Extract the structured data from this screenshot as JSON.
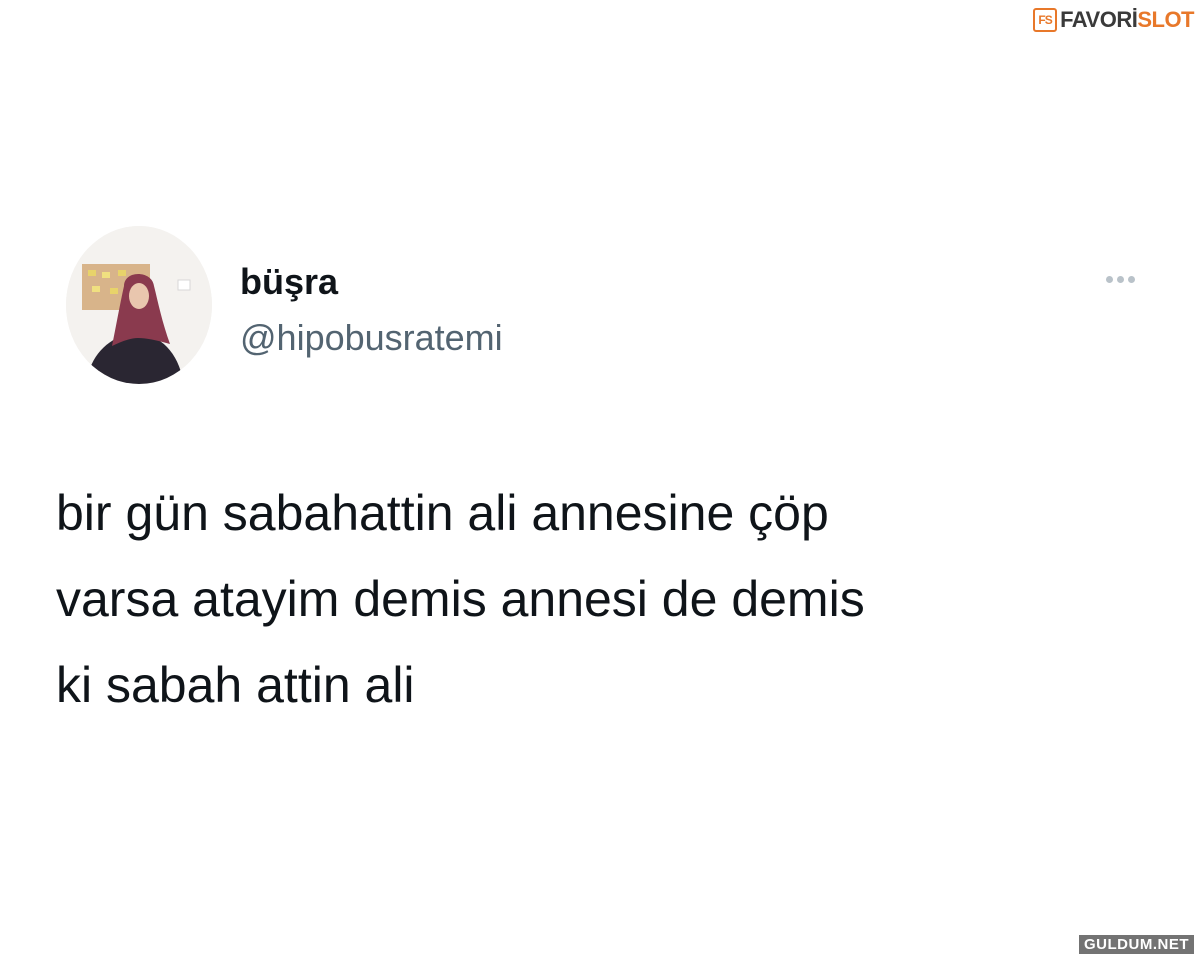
{
  "watermark": {
    "logo_mark": "FS",
    "brand_part1": "FAVORİ",
    "brand_part2": "SLOT",
    "accent_color": "#e8782a",
    "footer": "GULDUM.NET"
  },
  "tweet": {
    "display_name": "büşra",
    "handle": "@hipobusratemi",
    "avatar_icon": "profile-photo",
    "more_icon": "ellipsis-icon",
    "text_lines": [
      "bir gün sabahattin ali annesine çöp",
      "varsa atayim demis annesi de demis",
      "ki sabah attin ali"
    ]
  },
  "colors": {
    "text_primary": "#0f1419",
    "text_secondary": "#536471",
    "background": "#ffffff"
  }
}
